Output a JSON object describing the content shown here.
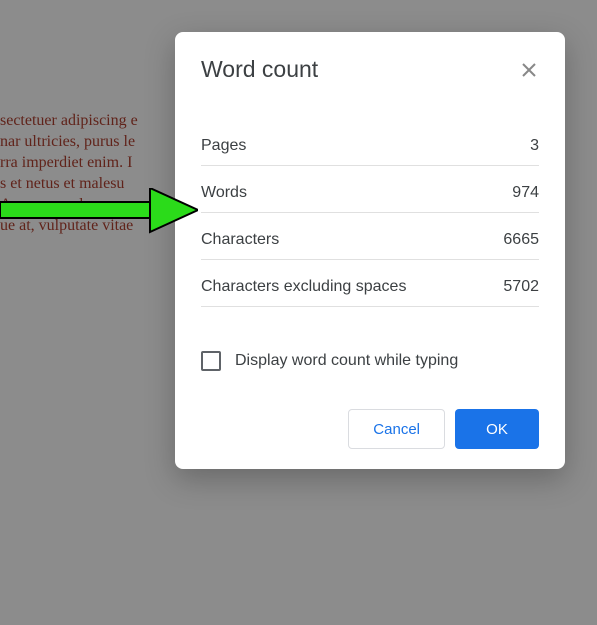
{
  "doc": {
    "line1": "sectetuer adipiscing e",
    "line2": "nar ultricies, purus le",
    "line3": "rra imperdiet enim. I",
    "line4": "s et netus et malesu",
    "line5": "Aenean nec lorem",
    "line6": "ue at, vulputate vitae"
  },
  "dialog": {
    "title": "Word count",
    "stats": {
      "pages_label": "Pages",
      "pages_value": "3",
      "words_label": "Words",
      "words_value": "974",
      "chars_label": "Characters",
      "chars_value": "6665",
      "chars_nospaces_label": "Characters excluding spaces",
      "chars_nospaces_value": "5702"
    },
    "checkbox_label": "Display word count while typing",
    "cancel_label": "Cancel",
    "ok_label": "OK"
  }
}
